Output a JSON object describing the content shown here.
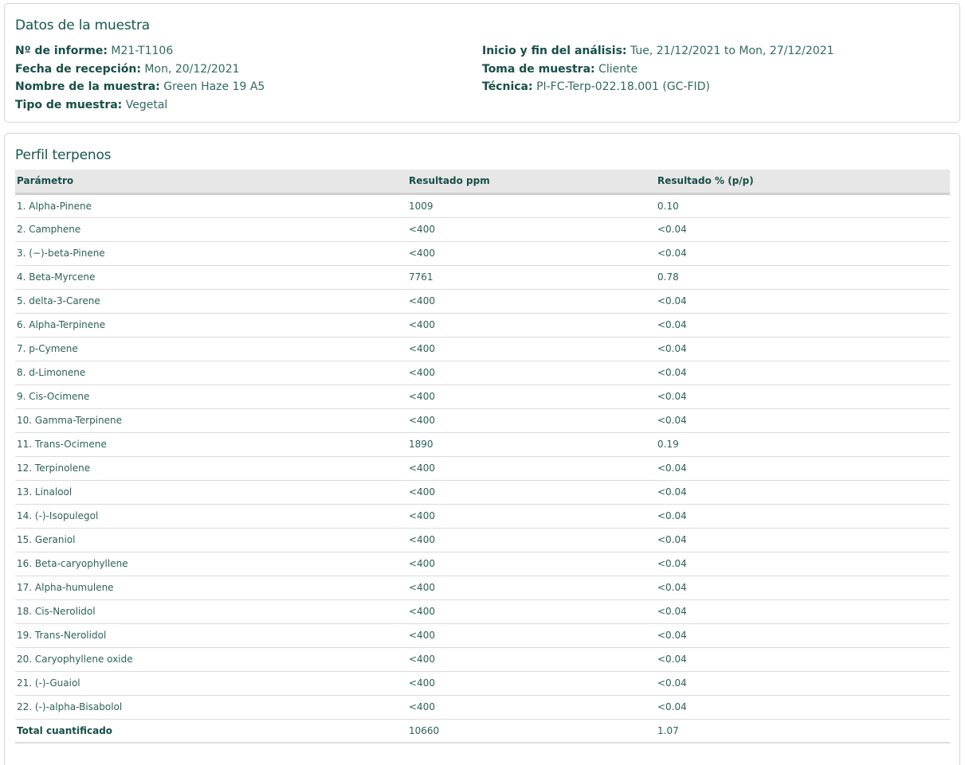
{
  "sample": {
    "title": "Datos de la muestra",
    "left_fields": [
      {
        "label": "Nº de informe:",
        "value": "M21-T1106"
      },
      {
        "label": "Fecha de recepción:",
        "value": "Mon, 20/12/2021"
      },
      {
        "label": "Nombre de la muestra:",
        "value": "Green Haze 19 A5"
      },
      {
        "label": "Tipo de muestra:",
        "value": "Vegetal"
      }
    ],
    "right_fields": [
      {
        "label": "Inicio y fin del análisis:",
        "value": "Tue, 21/12/2021 to Mon, 27/12/2021"
      },
      {
        "label": "Toma de muestra:",
        "value": "Cliente"
      },
      {
        "label": "Técnica:",
        "value": "PI-FC-Terp-022.18.001 (GC-FID)"
      }
    ]
  },
  "terpenes": {
    "title": "Perfil terpenos",
    "headers": {
      "param": "Parámetro",
      "ppm": "Resultado ppm",
      "pct": "Resultado % (p/p)"
    },
    "rows": [
      {
        "param": "1. Alpha-Pinene",
        "ppm": "1009",
        "pct": "0.10"
      },
      {
        "param": "2. Camphene",
        "ppm": "<400",
        "pct": "<0.04"
      },
      {
        "param": "3. (−)-beta-Pinene",
        "ppm": "<400",
        "pct": "<0.04"
      },
      {
        "param": "4. Beta-Myrcene",
        "ppm": "7761",
        "pct": "0.78"
      },
      {
        "param": "5. delta-3-Carene",
        "ppm": "<400",
        "pct": "<0.04"
      },
      {
        "param": "6. Alpha-Terpinene",
        "ppm": "<400",
        "pct": "<0.04"
      },
      {
        "param": "7. p-Cymene",
        "ppm": "<400",
        "pct": "<0.04"
      },
      {
        "param": "8. d-Limonene",
        "ppm": "<400",
        "pct": "<0.04"
      },
      {
        "param": "9. Cis-Ocimene",
        "ppm": "<400",
        "pct": "<0.04"
      },
      {
        "param": "10. Gamma-Terpinene",
        "ppm": "<400",
        "pct": "<0.04"
      },
      {
        "param": "11. Trans-Ocimene",
        "ppm": "1890",
        "pct": "0.19"
      },
      {
        "param": "12. Terpinolene",
        "ppm": "<400",
        "pct": "<0.04"
      },
      {
        "param": "13. Linalool",
        "ppm": "<400",
        "pct": "<0.04"
      },
      {
        "param": "14. (-)-Isopulegol",
        "ppm": "<400",
        "pct": "<0.04"
      },
      {
        "param": "15. Geraniol",
        "ppm": "<400",
        "pct": "<0.04"
      },
      {
        "param": "16. Beta-caryophyllene",
        "ppm": "<400",
        "pct": "<0.04"
      },
      {
        "param": "17. Alpha-humulene",
        "ppm": "<400",
        "pct": "<0.04"
      },
      {
        "param": "18. Cis-Nerolidol",
        "ppm": "<400",
        "pct": "<0.04"
      },
      {
        "param": "19. Trans-Nerolidol",
        "ppm": "<400",
        "pct": "<0.04"
      },
      {
        "param": "20. Caryophyllene oxide",
        "ppm": "<400",
        "pct": "<0.04"
      },
      {
        "param": "21. (-)-Guaiol",
        "ppm": "<400",
        "pct": "<0.04"
      },
      {
        "param": "22. (-)-alpha-Bisabolol",
        "ppm": "<400",
        "pct": "<0.04"
      }
    ],
    "total": {
      "param": "Total cuantificado",
      "ppm": "10660",
      "pct": "1.07"
    }
  }
}
